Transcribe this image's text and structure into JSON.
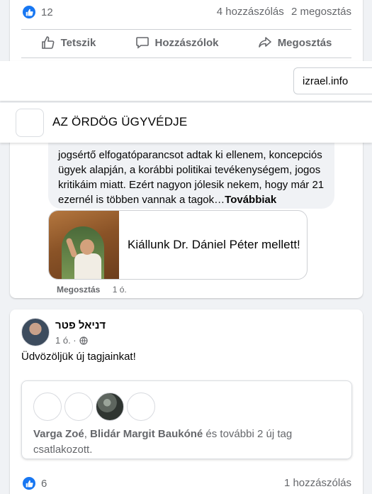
{
  "post1": {
    "like_count": "12",
    "comments": "4 hozzászólás",
    "shares": "2 megosztás",
    "actions": {
      "like": "Tetszik",
      "comment": "Hozzászólok",
      "share": "Megosztás"
    }
  },
  "topbar": {
    "url_value": "izrael.info"
  },
  "group": {
    "name": "AZ ÖRDÖG ÜGYVÉDJE"
  },
  "post2": {
    "line1": "jogsértő elfogatóparancsot adtak ki ellenem, koncepciós",
    "line2": "ügyek alapján, a korábbi politikai tevékenységem, jogos",
    "line3": "kritikáim miatt. Ezért nagyon jólesik nekem, hogy már 21",
    "line4": "ezernél is többen vannak a tagok…",
    "more": "Továbbiak",
    "link_title": "Kiállunk Dr. Dániel Péter mellett!",
    "share_label": "Megosztás",
    "time": "1 ó."
  },
  "post3": {
    "author": "דניאל פטר",
    "time": "1 ó. ·",
    "text": "Üdvözöljük új tagjainkat!",
    "member1": "Varga Zoé",
    "sep": ", ",
    "member2": "Blidár Margit Baukóné",
    "joined_rest": " és további 2 új tag csatlakozott.",
    "like_count": "6",
    "comments": "1 hozzászólás"
  },
  "colors": {
    "accent": "#1877f2",
    "muted": "#65676b",
    "background": "#f0f2f5"
  },
  "icons": {
    "like": "thumbs-up-icon",
    "comment": "speech-bubble-icon",
    "share": "share-arrow-icon",
    "globe": "globe-icon"
  }
}
